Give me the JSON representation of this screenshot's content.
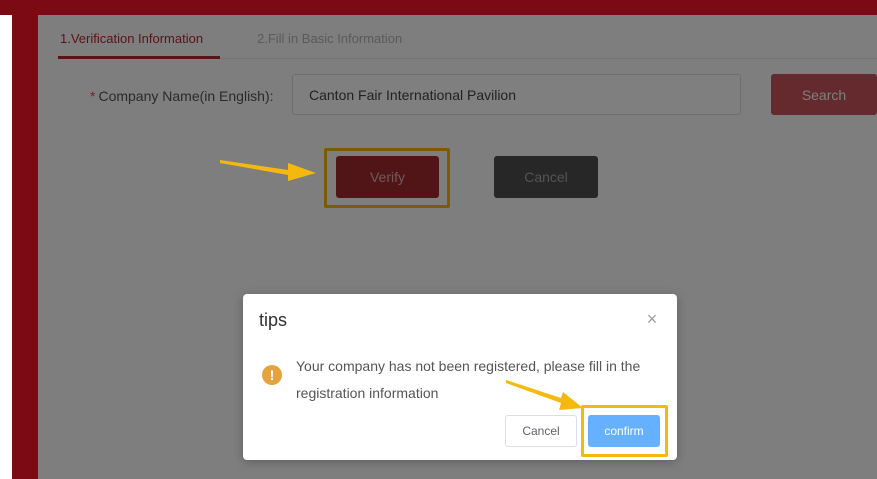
{
  "tabs": {
    "step1": "1.Verification Information",
    "step2": "2.Fill in Basic Information"
  },
  "form": {
    "required_mark": "*",
    "company_label": "Company Name(in English):",
    "company_value": "Canton Fair International Pavilion",
    "search_label": "Search",
    "verify_label": "Verify",
    "cancel_label": "Cancel"
  },
  "dialog": {
    "title": "tips",
    "close_glyph": "×",
    "icon_glyph": "!",
    "message": "Your company has not been registered, please fill in the registration information",
    "cancel_label": "Cancel",
    "confirm_label": "confirm"
  },
  "colors": {
    "brand_dark_red": "#7c0a14",
    "accent_red": "#b5292f",
    "highlight_yellow": "#f5b90e",
    "confirm_blue": "#66b1ff",
    "warning_orange": "#e6a23c"
  }
}
